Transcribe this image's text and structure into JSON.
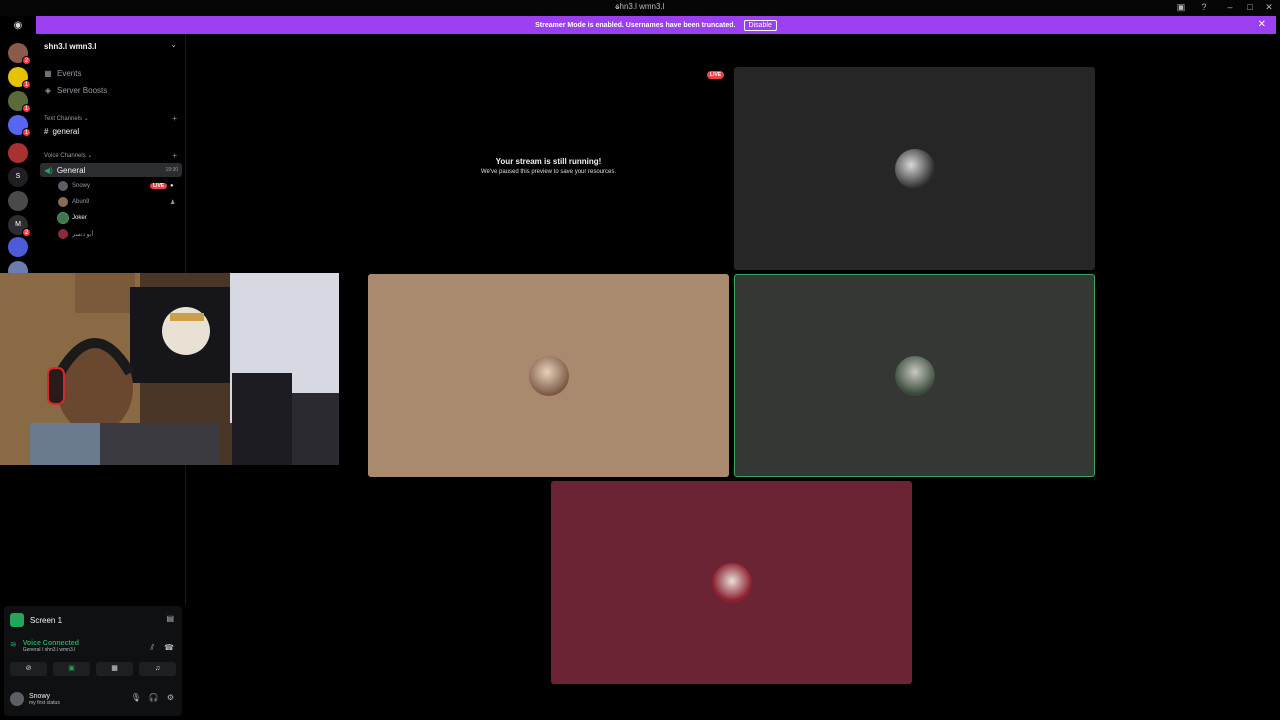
{
  "titlebar": {
    "title": "shn3.l wmn3.l"
  },
  "banner": {
    "text": "Streamer Mode is enabled. Usernames have been truncated.",
    "disable_label": "Disable"
  },
  "rail": {
    "badges": [
      "2",
      "1",
      "1",
      "1",
      "2"
    ],
    "letters": [
      "S",
      "M"
    ]
  },
  "sidebar": {
    "server_name": "shn3.l wmn3.l",
    "events_label": "Events",
    "boosts_label": "Server Boosts",
    "text_category": "Text Channels",
    "text_channel": "general",
    "voice_category": "Voice Channels",
    "voice_channel": "General",
    "voice_timer": "19:30",
    "users": [
      {
        "name": "Snowy",
        "live": "LIVE"
      },
      {
        "name": "Abun9"
      },
      {
        "name": "Joker"
      },
      {
        "name": "أبو دنسر"
      }
    ]
  },
  "stage": {
    "live_label": "LIVE",
    "paused_title": "Your stream is still running!",
    "paused_sub": "We've paused this preview to save your resources."
  },
  "panel": {
    "screen_label": "Screen 1",
    "voice_status": "Voice Connected",
    "voice_location": "General / shn3.l wmn3.l",
    "user_name": "Snowy",
    "user_status": "my first status"
  },
  "colors": {
    "accent_banner": "#9b3ff0",
    "voice_green": "#23a55a",
    "live_red": "#ed4245",
    "tile_tan": "#a98a6e",
    "tile_darkgray": "#343734",
    "tile_gray": "#262626",
    "tile_maroon": "#6b2434"
  }
}
